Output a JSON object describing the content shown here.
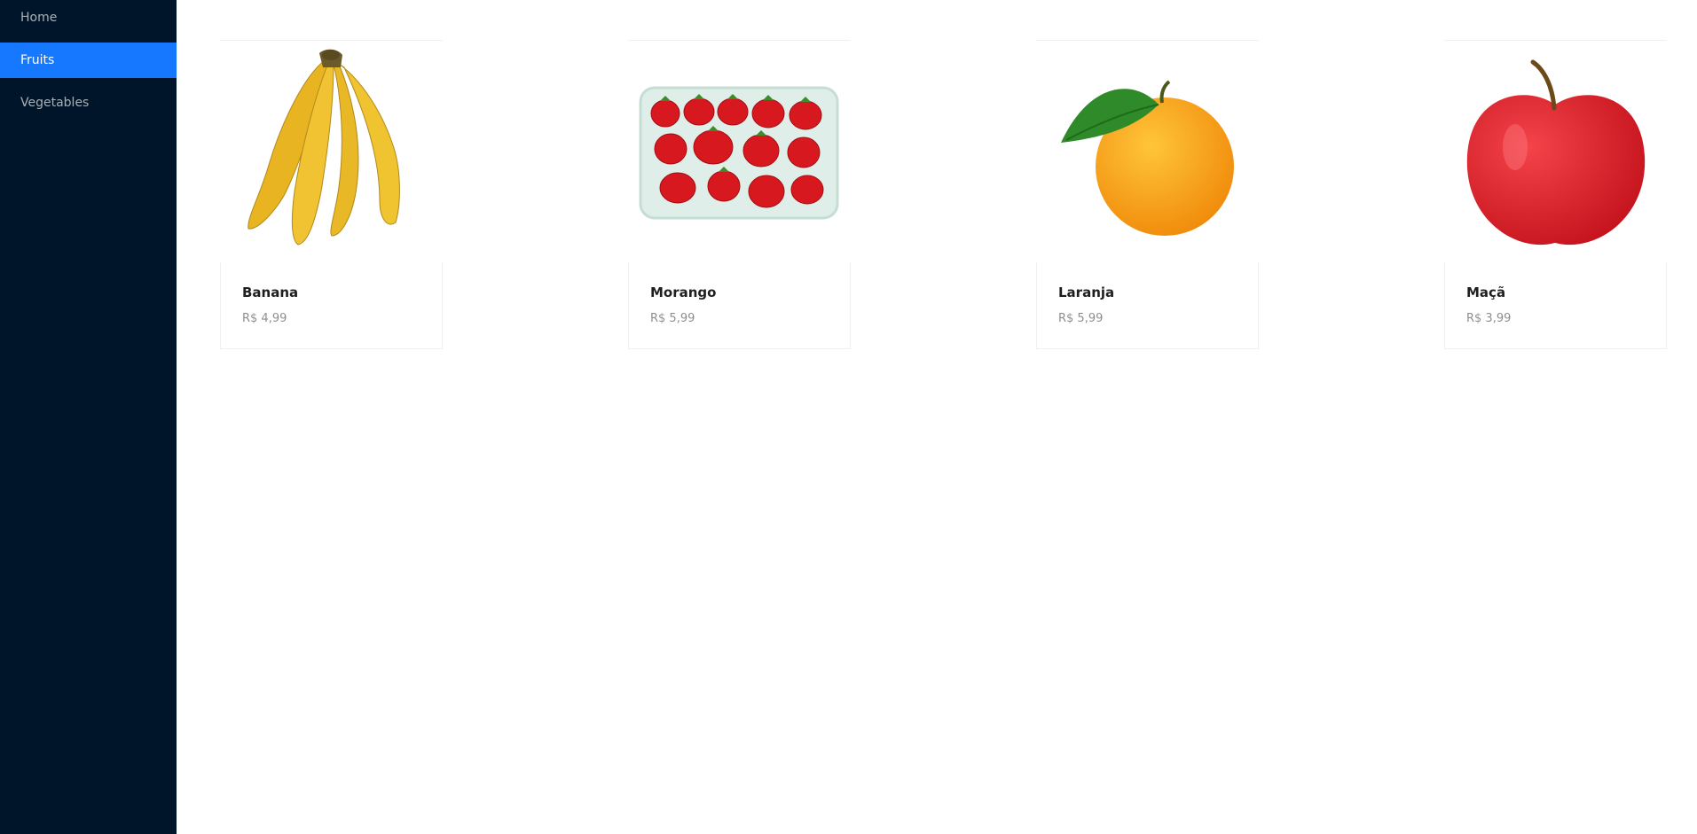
{
  "sidebar": {
    "items": [
      {
        "label": "Home",
        "active": false
      },
      {
        "label": "Fruits",
        "active": true
      },
      {
        "label": "Vegetables",
        "active": false
      }
    ]
  },
  "products": [
    {
      "name": "Banana",
      "price": "R$ 4,99",
      "image": "banana-bunch"
    },
    {
      "name": "Morango",
      "price": "R$ 5,99",
      "image": "strawberry-tray"
    },
    {
      "name": "Laranja",
      "price": "R$ 5,99",
      "image": "orange-with-leaf"
    },
    {
      "name": "Maçã",
      "price": "R$ 3,99",
      "image": "red-apple"
    }
  ],
  "colors": {
    "sidebar_bg": "#001529",
    "accent": "#1677ff"
  }
}
